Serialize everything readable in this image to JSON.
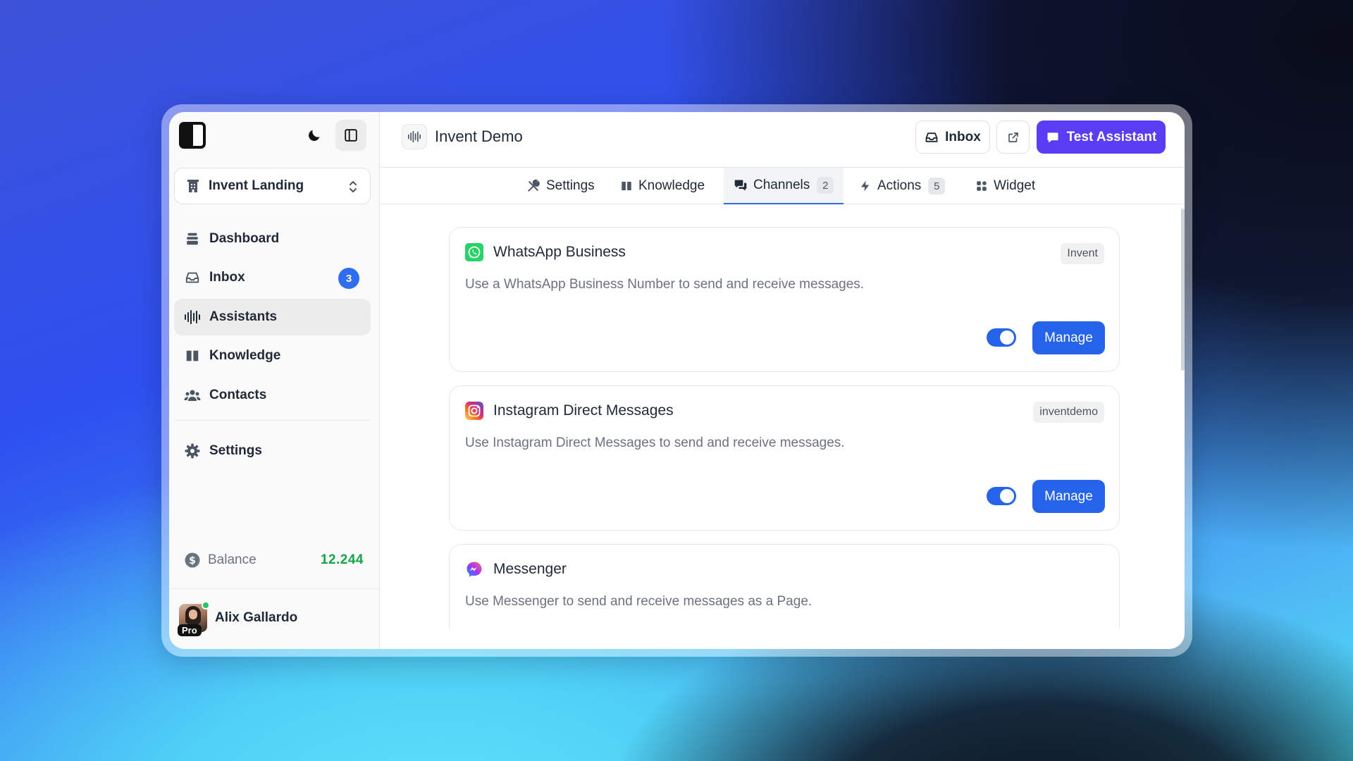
{
  "sidebar": {
    "project": "Invent Landing",
    "nav": [
      {
        "label": "Dashboard",
        "icon": "dashboard-icon"
      },
      {
        "label": "Inbox",
        "icon": "inbox-icon",
        "badge": "3"
      },
      {
        "label": "Assistants",
        "icon": "waveform-icon",
        "active": true
      },
      {
        "label": "Knowledge",
        "icon": "book-icon"
      },
      {
        "label": "Contacts",
        "icon": "users-icon"
      }
    ],
    "settings_label": "Settings",
    "balance_label": "Balance",
    "balance_value": "12.244",
    "user_name": "Alix Gallardo",
    "user_plan": "Pro"
  },
  "header": {
    "title": "Invent Demo",
    "inbox_label": "Inbox",
    "test_label": "Test Assistant"
  },
  "tabs": [
    {
      "label": "Settings"
    },
    {
      "label": "Knowledge"
    },
    {
      "label": "Channels",
      "count": "2",
      "active": true
    },
    {
      "label": "Actions",
      "count": "5"
    },
    {
      "label": "Widget"
    }
  ],
  "channels": [
    {
      "name": "WhatsApp Business",
      "tag": "Invent",
      "description": "Use a WhatsApp Business Number to send and receive messages.",
      "enabled": true,
      "manage_label": "Manage"
    },
    {
      "name": "Instagram Direct Messages",
      "tag": "inventdemo",
      "description": "Use Instagram Direct Messages to send and receive messages.",
      "enabled": true,
      "manage_label": "Manage"
    },
    {
      "name": "Messenger",
      "description": "Use Messenger to send and receive messages as a Page."
    }
  ],
  "colors": {
    "accent": "#2563eb",
    "primary_button": "#5b3cf5",
    "balance": "#16a34a"
  }
}
